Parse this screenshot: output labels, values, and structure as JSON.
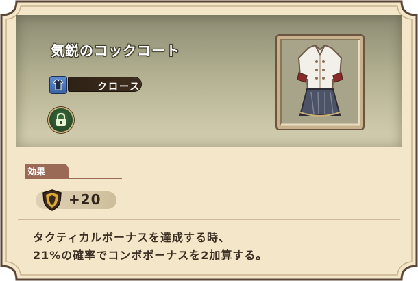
{
  "item": {
    "name": "気鋭のコックコート",
    "type_label": "クロース",
    "type_icon": "clothing-icon",
    "lock_icon": "lock-icon"
  },
  "effects": {
    "header": "効果",
    "stat_icon": "shield-icon",
    "stat_value": "+20",
    "description_lines": [
      "タクティカルボーナスを達成する時、",
      "21%の確率でコンボボーナスを2加算する。"
    ]
  },
  "colors": {
    "parchment": "#f4e6c8",
    "frame": "#5a4636",
    "header_panel_top": "#8d8c74",
    "header_panel_bottom": "#d6d0b2",
    "section_tag": "#9a6a56",
    "text_dark": "#3a2e22"
  }
}
